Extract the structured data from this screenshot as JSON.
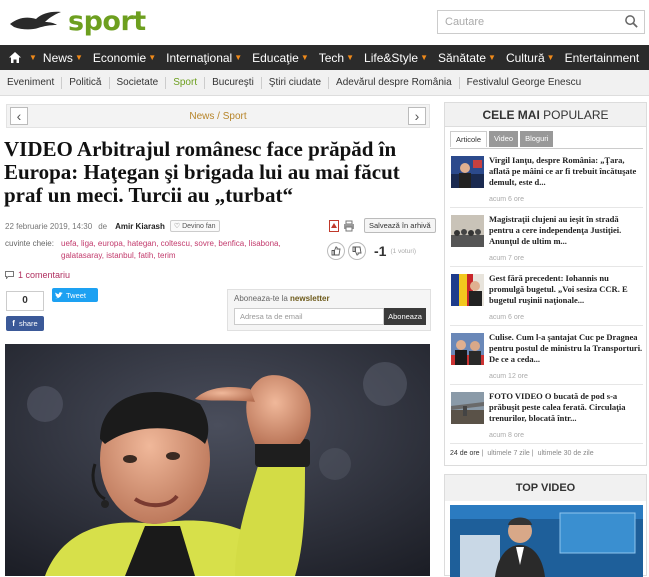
{
  "header": {
    "logo_text": "sport",
    "search_placeholder": "Cautare",
    "brand_color": "#6d9f1f"
  },
  "nav": {
    "items": [
      "News",
      "Economie",
      "Internaţional",
      "Educaţie",
      "Tech",
      "Life&Style",
      "Sănătate",
      "Cultură",
      "Entertainment"
    ]
  },
  "subnav": {
    "items": [
      "Eveniment",
      "Politică",
      "Societate",
      "Sport",
      "Bucureşti",
      "Ştiri ciudate",
      "Adevărul despre România",
      "Festivalul George Enescu"
    ],
    "active": "Sport"
  },
  "article": {
    "breadcrumb": "News / Sport",
    "title": "VIDEO Arbitrajul românesc face prăpăd în Europa: Haţegan şi brigada lui au mai făcut praf un meci. Turcii au „turbat“",
    "date": "22 februarie 2019, 14:30",
    "by": "de",
    "author": "Amir Kiarash",
    "fan_button": "♡ Devino fan",
    "save_button": "Salvează în arhivă",
    "tags_label": "cuvinte cheie:",
    "tags": "uefa, liga, europa, hategan, coltescu, sovre, benfica, lisabona, galatasaray, istanbul, fatih, terim",
    "vote_score": "-1",
    "vote_count": "(1 voturi)",
    "comments": "1 comentariu",
    "like_count": "0",
    "tweet_label": "Tweet",
    "share_label": "share"
  },
  "newsletter": {
    "title_prefix": "Aboneaza-te la ",
    "title_bold": "newsletter",
    "placeholder": "Adresa ta de email",
    "button": "Aboneaza"
  },
  "sidebar": {
    "title_bold": "CELE MAI",
    "title_rest": " POPULARE",
    "tabs": [
      "Articole",
      "Video",
      "Bloguri"
    ],
    "items": [
      {
        "text": "Virgil Ianţu, despre România: „Ţara, aflată pe mâini ce ar fi trebuit încătuşate demult, este d...",
        "time": "acum 6 ore"
      },
      {
        "text": "Magistraţii clujeni au ieşit în stradă pentru a cere independenţa Justiţiei. Anunţul de ultim m...",
        "time": "acum 7 ore"
      },
      {
        "text": "Gest fără precedent: Iohannis nu promulgă bugetul. „Voi sesiza CCR. E bugetul ruşinii naţionale...",
        "time": "acum 6 ore"
      },
      {
        "text": "Culise. Cum l-a şantajat Cuc pe Dragnea pentru postul de ministru la Transporturi. De ce a ceda...",
        "time": "acum 12 ore"
      },
      {
        "text": "FOTO VIDEO O bucată de pod s-a prăbuşit peste calea ferată. Circulaţia trenurilor, blocată într...",
        "time": "acum 8 ore"
      }
    ],
    "footer": [
      "24 de ore",
      "ultimele 7 zile",
      "ultimele 30 de zile"
    ]
  },
  "topvideo": {
    "title": "TOP VIDEO"
  }
}
